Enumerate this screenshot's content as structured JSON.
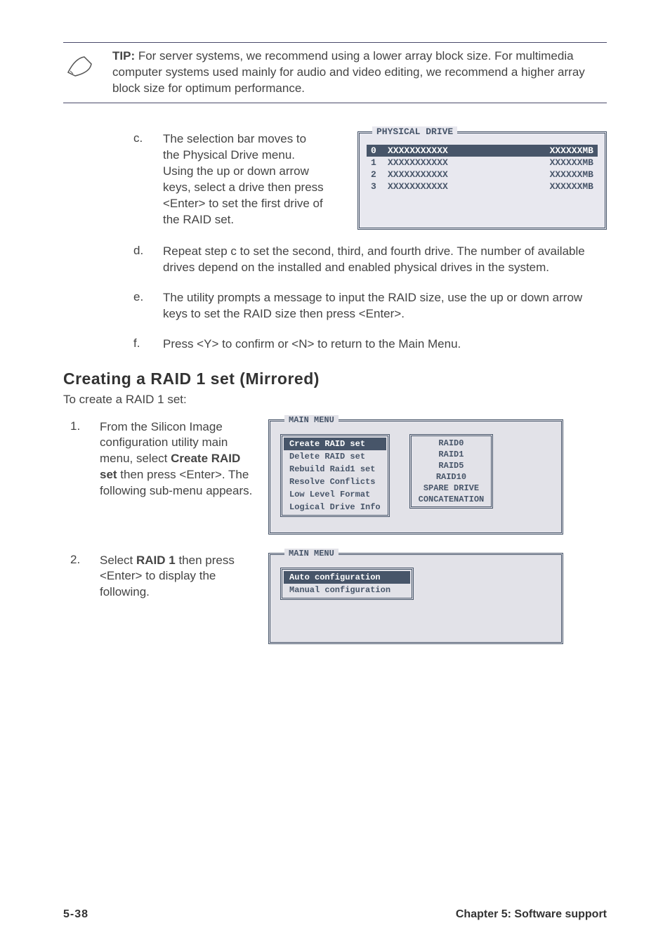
{
  "tip": {
    "label": "TIP:",
    "text": " For server systems, we recommend using a lower array block size. For multimedia computer systems used mainly for audio and video editing, we recommend a higher array block size for optimum performance."
  },
  "steps_c_to_f": {
    "c": {
      "letter": "c.",
      "text": "The selection bar moves to the Physical Drive menu. Using the up or down arrow keys, select a drive then press <Enter> to set the first drive of the RAID set."
    },
    "d": {
      "letter": "d.",
      "text": "Repeat step c to set the second, third, and fourth drive. The number of available drives depend on the installed and enabled physical drives in the system."
    },
    "e": {
      "letter": "e.",
      "text": "The utility prompts a message to input the RAID size, use the up or down arrow keys to set the RAID size then press <Enter>."
    },
    "f": {
      "letter": "f.",
      "text": "Press <Y> to confirm or <N> to return to the Main Menu."
    }
  },
  "physical_drive": {
    "title": "PHYSICAL DRIVE",
    "rows": [
      {
        "idx": "0",
        "name": "XXXXXXXXXXX",
        "size": "XXXXXXMB"
      },
      {
        "idx": "1",
        "name": "XXXXXXXXXXX",
        "size": "XXXXXXMB"
      },
      {
        "idx": "2",
        "name": "XXXXXXXXXXX",
        "size": "XXXXXXMB"
      },
      {
        "idx": "3",
        "name": "XXXXXXXXXXX",
        "size": "XXXXXXMB"
      }
    ]
  },
  "section": {
    "heading": "Creating a RAID 1 set (Mirrored)",
    "intro": "To create a RAID 1 set:"
  },
  "num_steps": {
    "s1": {
      "num": "1.",
      "pre": "From the Silicon Image configuration utility main menu, select ",
      "bold": "Create RAID set",
      "post": " then press <Enter>. The following sub-menu appears."
    },
    "s2": {
      "num": "2.",
      "pre": "Select ",
      "bold": "RAID 1",
      "post": " then press <Enter> to display the following."
    }
  },
  "main_menu": {
    "title": "MAIN MENU",
    "items": [
      "Create RAID set",
      "Delete RAID set",
      "Rebuild Raid1 set",
      "Resolve Conflicts",
      "Low Level Format",
      "Logical Drive Info"
    ],
    "raid_options": [
      "RAID0",
      "RAID1",
      "RAID5",
      "RAID10",
      "SPARE DRIVE",
      "CONCATENATION"
    ]
  },
  "main_menu2": {
    "title": "MAIN MENU",
    "items": [
      "Auto configuration",
      "Manual configuration"
    ]
  },
  "footer": {
    "page_num": "5-38",
    "chapter": "Chapter 5: Software support"
  }
}
